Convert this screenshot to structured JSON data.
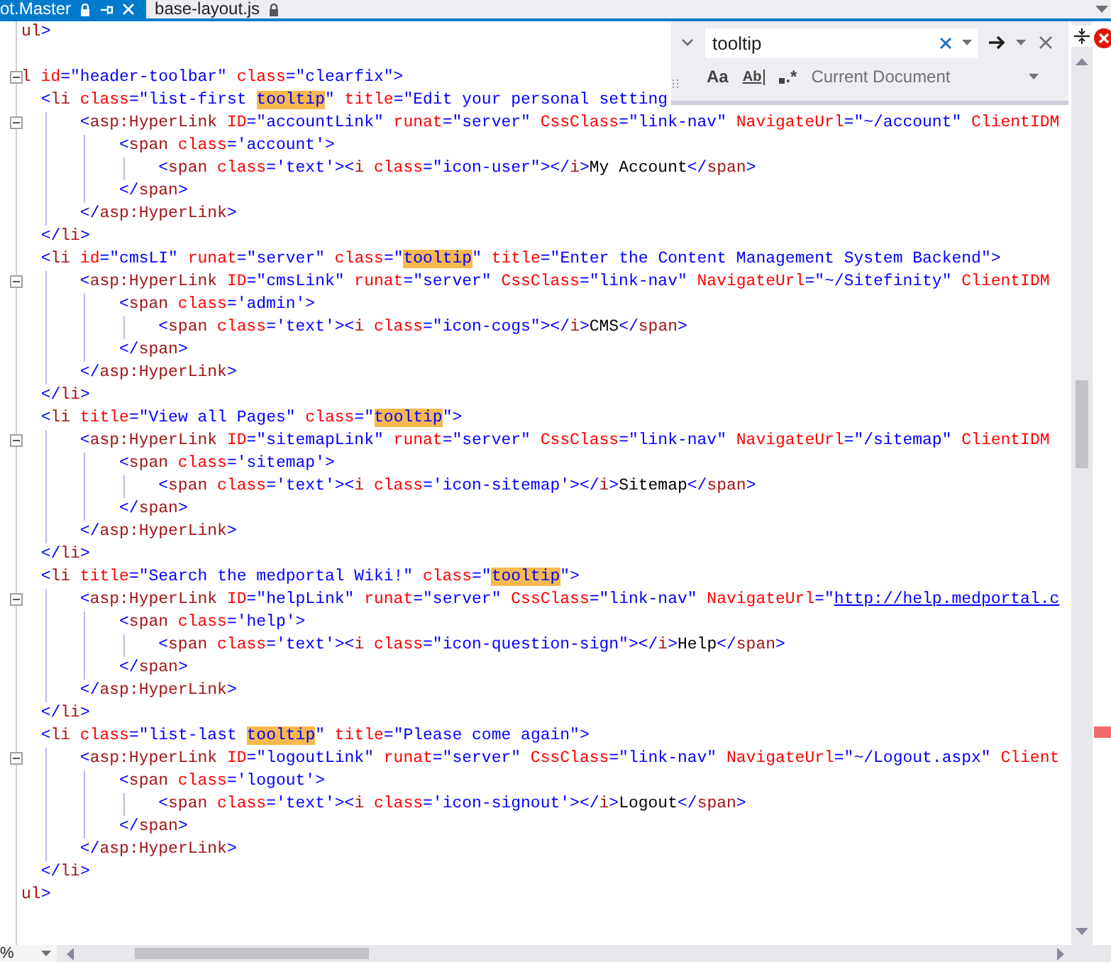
{
  "tabs": [
    {
      "label": "ot.Master",
      "selected": true,
      "locked": true
    },
    {
      "label": "base-layout.js",
      "selected": false,
      "locked": true
    }
  ],
  "find": {
    "value": "tooltip",
    "options": [
      {
        "label": "Aa"
      },
      {
        "label": "Ab"
      },
      {
        "label": ".*"
      }
    ],
    "scope": "Current Document"
  },
  "editor": {
    "lines": [
      {
        "collapsible": false,
        "tokens": [
          {
            "kind": "tag",
            "text": "ul"
          },
          {
            "kind": "delim",
            "text": ">"
          }
        ]
      },
      {
        "collapsible": false
      },
      {
        "collapsible": true,
        "tokens": [
          {
            "kind": "tag",
            "text": "l"
          },
          {
            "kind": "attr",
            "text": " id"
          },
          {
            "kind": "value",
            "text": "=\"header-toolbar\""
          },
          {
            "kind": "attr",
            "text": " class"
          },
          {
            "kind": "value",
            "text": "=\"clearfix\""
          },
          {
            "kind": "delim",
            "text": ">"
          }
        ]
      },
      {
        "collapsible": false,
        "tokens": [
          {
            "kind": "delim",
            "text": "  <"
          },
          {
            "kind": "tag",
            "text": "li"
          },
          {
            "kind": "attr",
            "text": " class"
          },
          {
            "kind": "value",
            "text": "=\"list-first "
          },
          {
            "kind": "match",
            "text": "tooltip"
          },
          {
            "kind": "value",
            "text": "\""
          },
          {
            "kind": "attr",
            "text": " title"
          },
          {
            "kind": "value",
            "text": "=\"Edit your personal setting"
          }
        ]
      },
      {
        "collapsible": true,
        "tokens": [
          {
            "kind": "delim",
            "text": "      <"
          },
          {
            "kind": "tag",
            "text": "asp:HyperLink"
          },
          {
            "kind": "attr",
            "text": " ID"
          },
          {
            "kind": "value",
            "text": "=\"accountLink\""
          },
          {
            "kind": "attr",
            "text": " runat"
          },
          {
            "kind": "value",
            "text": "=\"server\""
          },
          {
            "kind": "attr",
            "text": " CssClass"
          },
          {
            "kind": "value",
            "text": "=\"link-nav\""
          },
          {
            "kind": "attr",
            "text": " NavigateUrl"
          },
          {
            "kind": "value",
            "text": "=\"~/account\""
          },
          {
            "kind": "attr",
            "text": " ClientIDM"
          }
        ]
      },
      {
        "collapsible": false,
        "tokens": [
          {
            "kind": "delim",
            "text": "          <"
          },
          {
            "kind": "tag",
            "text": "span"
          },
          {
            "kind": "attr",
            "text": " class"
          },
          {
            "kind": "value",
            "text": "='account'"
          },
          {
            "kind": "delim",
            "text": ">"
          }
        ]
      },
      {
        "collapsible": false,
        "tokens": [
          {
            "kind": "delim",
            "text": "              <"
          },
          {
            "kind": "tag",
            "text": "span"
          },
          {
            "kind": "attr",
            "text": " class"
          },
          {
            "kind": "value",
            "text": "='text'"
          },
          {
            "kind": "delim",
            "text": "><"
          },
          {
            "kind": "tag",
            "text": "i"
          },
          {
            "kind": "attr",
            "text": " class"
          },
          {
            "kind": "value",
            "text": "=\"icon-user\""
          },
          {
            "kind": "delim",
            "text": "></"
          },
          {
            "kind": "tag",
            "text": "i"
          },
          {
            "kind": "delim",
            "text": ">"
          },
          {
            "kind": "text",
            "text": "My Account"
          },
          {
            "kind": "delim",
            "text": "</"
          },
          {
            "kind": "tag",
            "text": "span"
          },
          {
            "kind": "delim",
            "text": ">"
          }
        ]
      },
      {
        "collapsible": false,
        "tokens": [
          {
            "kind": "delim",
            "text": "          </"
          },
          {
            "kind": "tag",
            "text": "span"
          },
          {
            "kind": "delim",
            "text": ">"
          }
        ]
      },
      {
        "collapsible": false,
        "tokens": [
          {
            "kind": "delim",
            "text": "      </"
          },
          {
            "kind": "tag",
            "text": "asp:HyperLink"
          },
          {
            "kind": "delim",
            "text": ">"
          }
        ]
      },
      {
        "collapsible": false,
        "tokens": [
          {
            "kind": "delim",
            "text": "  </"
          },
          {
            "kind": "tag",
            "text": "li"
          },
          {
            "kind": "delim",
            "text": ">"
          }
        ]
      },
      {
        "collapsible": false,
        "tokens": [
          {
            "kind": "delim",
            "text": "  <"
          },
          {
            "kind": "tag",
            "text": "li"
          },
          {
            "kind": "attr",
            "text": " id"
          },
          {
            "kind": "value",
            "text": "=\"cmsLI\""
          },
          {
            "kind": "attr",
            "text": " runat"
          },
          {
            "kind": "value",
            "text": "=\"server\""
          },
          {
            "kind": "attr",
            "text": " class"
          },
          {
            "kind": "value",
            "text": "=\""
          },
          {
            "kind": "match",
            "text": "tooltip"
          },
          {
            "kind": "value",
            "text": "\""
          },
          {
            "kind": "attr",
            "text": " title"
          },
          {
            "kind": "value",
            "text": "=\"Enter the Content Management System Backend\""
          },
          {
            "kind": "delim",
            "text": ">"
          }
        ]
      },
      {
        "collapsible": true,
        "tokens": [
          {
            "kind": "delim",
            "text": "      <"
          },
          {
            "kind": "tag",
            "text": "asp:HyperLink"
          },
          {
            "kind": "attr",
            "text": " ID"
          },
          {
            "kind": "value",
            "text": "=\"cmsLink\""
          },
          {
            "kind": "attr",
            "text": " runat"
          },
          {
            "kind": "value",
            "text": "=\"server\""
          },
          {
            "kind": "attr",
            "text": " CssClass"
          },
          {
            "kind": "value",
            "text": "=\"link-nav\""
          },
          {
            "kind": "attr",
            "text": " NavigateUrl"
          },
          {
            "kind": "value",
            "text": "=\"~/Sitefinity\""
          },
          {
            "kind": "attr",
            "text": " ClientIDM"
          }
        ]
      },
      {
        "collapsible": false,
        "tokens": [
          {
            "kind": "delim",
            "text": "          <"
          },
          {
            "kind": "tag",
            "text": "span"
          },
          {
            "kind": "attr",
            "text": " class"
          },
          {
            "kind": "value",
            "text": "='admin'"
          },
          {
            "kind": "delim",
            "text": ">"
          }
        ]
      },
      {
        "collapsible": false,
        "tokens": [
          {
            "kind": "delim",
            "text": "              <"
          },
          {
            "kind": "tag",
            "text": "span"
          },
          {
            "kind": "attr",
            "text": " class"
          },
          {
            "kind": "value",
            "text": "='text'"
          },
          {
            "kind": "delim",
            "text": "><"
          },
          {
            "kind": "tag",
            "text": "i"
          },
          {
            "kind": "attr",
            "text": " class"
          },
          {
            "kind": "value",
            "text": "=\"icon-cogs\""
          },
          {
            "kind": "delim",
            "text": "></"
          },
          {
            "kind": "tag",
            "text": "i"
          },
          {
            "kind": "delim",
            "text": ">"
          },
          {
            "kind": "text",
            "text": "CMS"
          },
          {
            "kind": "delim",
            "text": "</"
          },
          {
            "kind": "tag",
            "text": "span"
          },
          {
            "kind": "delim",
            "text": ">"
          }
        ]
      },
      {
        "collapsible": false,
        "tokens": [
          {
            "kind": "delim",
            "text": "          </"
          },
          {
            "kind": "tag",
            "text": "span"
          },
          {
            "kind": "delim",
            "text": ">"
          }
        ]
      },
      {
        "collapsible": false,
        "tokens": [
          {
            "kind": "delim",
            "text": "      </"
          },
          {
            "kind": "tag",
            "text": "asp:HyperLink"
          },
          {
            "kind": "delim",
            "text": ">"
          }
        ]
      },
      {
        "collapsible": false,
        "tokens": [
          {
            "kind": "delim",
            "text": "  </"
          },
          {
            "kind": "tag",
            "text": "li"
          },
          {
            "kind": "delim",
            "text": ">"
          }
        ]
      },
      {
        "collapsible": false,
        "tokens": [
          {
            "kind": "delim",
            "text": "  <"
          },
          {
            "kind": "tag",
            "text": "li"
          },
          {
            "kind": "attr",
            "text": " title"
          },
          {
            "kind": "value",
            "text": "=\"View all Pages\""
          },
          {
            "kind": "attr",
            "text": " class"
          },
          {
            "kind": "value",
            "text": "=\""
          },
          {
            "kind": "match",
            "text": "tooltip"
          },
          {
            "kind": "value",
            "text": "\""
          },
          {
            "kind": "delim",
            "text": ">"
          }
        ]
      },
      {
        "collapsible": true,
        "tokens": [
          {
            "kind": "delim",
            "text": "      <"
          },
          {
            "kind": "tag",
            "text": "asp:HyperLink"
          },
          {
            "kind": "attr",
            "text": " ID"
          },
          {
            "kind": "value",
            "text": "=\"sitemapLink\""
          },
          {
            "kind": "attr",
            "text": " runat"
          },
          {
            "kind": "value",
            "text": "=\"server\""
          },
          {
            "kind": "attr",
            "text": " CssClass"
          },
          {
            "kind": "value",
            "text": "=\"link-nav\""
          },
          {
            "kind": "attr",
            "text": " NavigateUrl"
          },
          {
            "kind": "value",
            "text": "=\"/sitemap\""
          },
          {
            "kind": "attr",
            "text": " ClientIDM"
          }
        ]
      },
      {
        "collapsible": false,
        "tokens": [
          {
            "kind": "delim",
            "text": "          <"
          },
          {
            "kind": "tag",
            "text": "span"
          },
          {
            "kind": "attr",
            "text": " class"
          },
          {
            "kind": "value",
            "text": "='sitemap'"
          },
          {
            "kind": "delim",
            "text": ">"
          }
        ]
      },
      {
        "collapsible": false,
        "tokens": [
          {
            "kind": "delim",
            "text": "              <"
          },
          {
            "kind": "tag",
            "text": "span"
          },
          {
            "kind": "attr",
            "text": " class"
          },
          {
            "kind": "value",
            "text": "='text'"
          },
          {
            "kind": "delim",
            "text": "><"
          },
          {
            "kind": "tag",
            "text": "i"
          },
          {
            "kind": "attr",
            "text": " class"
          },
          {
            "kind": "value",
            "text": "='icon-sitemap'"
          },
          {
            "kind": "delim",
            "text": "></"
          },
          {
            "kind": "tag",
            "text": "i"
          },
          {
            "kind": "delim",
            "text": ">"
          },
          {
            "kind": "text",
            "text": "Sitemap"
          },
          {
            "kind": "delim",
            "text": "</"
          },
          {
            "kind": "tag",
            "text": "span"
          },
          {
            "kind": "delim",
            "text": ">"
          }
        ]
      },
      {
        "collapsible": false,
        "tokens": [
          {
            "kind": "delim",
            "text": "          </"
          },
          {
            "kind": "tag",
            "text": "span"
          },
          {
            "kind": "delim",
            "text": ">"
          }
        ]
      },
      {
        "collapsible": false,
        "tokens": [
          {
            "kind": "delim",
            "text": "      </"
          },
          {
            "kind": "tag",
            "text": "asp:HyperLink"
          },
          {
            "kind": "delim",
            "text": ">"
          }
        ]
      },
      {
        "collapsible": false,
        "tokens": [
          {
            "kind": "delim",
            "text": "  </"
          },
          {
            "kind": "tag",
            "text": "li"
          },
          {
            "kind": "delim",
            "text": ">"
          }
        ]
      },
      {
        "collapsible": false,
        "tokens": [
          {
            "kind": "delim",
            "text": "  <"
          },
          {
            "kind": "tag",
            "text": "li"
          },
          {
            "kind": "attr",
            "text": " title"
          },
          {
            "kind": "value",
            "text": "=\"Search the medportal Wiki!\""
          },
          {
            "kind": "attr",
            "text": " class"
          },
          {
            "kind": "value",
            "text": "=\""
          },
          {
            "kind": "match",
            "text": "tooltip"
          },
          {
            "kind": "value",
            "text": "\""
          },
          {
            "kind": "delim",
            "text": ">"
          }
        ]
      },
      {
        "collapsible": true,
        "tokens": [
          {
            "kind": "delim",
            "text": "      <"
          },
          {
            "kind": "tag",
            "text": "asp:HyperLink"
          },
          {
            "kind": "attr",
            "text": " ID"
          },
          {
            "kind": "value",
            "text": "=\"helpLink\""
          },
          {
            "kind": "attr",
            "text": " runat"
          },
          {
            "kind": "value",
            "text": "=\"server\""
          },
          {
            "kind": "attr",
            "text": " CssClass"
          },
          {
            "kind": "value",
            "text": "=\"link-nav\""
          },
          {
            "kind": "attr",
            "text": " NavigateUrl"
          },
          {
            "kind": "value",
            "text": "=\""
          },
          {
            "kind": "link",
            "text": "http://help.medportal.c"
          }
        ]
      },
      {
        "collapsible": false,
        "tokens": [
          {
            "kind": "delim",
            "text": "          <"
          },
          {
            "kind": "tag",
            "text": "span"
          },
          {
            "kind": "attr",
            "text": " class"
          },
          {
            "kind": "value",
            "text": "='help'"
          },
          {
            "kind": "delim",
            "text": ">"
          }
        ]
      },
      {
        "collapsible": false,
        "tokens": [
          {
            "kind": "delim",
            "text": "              <"
          },
          {
            "kind": "tag",
            "text": "span"
          },
          {
            "kind": "attr",
            "text": " class"
          },
          {
            "kind": "value",
            "text": "='text'"
          },
          {
            "kind": "delim",
            "text": "><"
          },
          {
            "kind": "tag",
            "text": "i"
          },
          {
            "kind": "attr",
            "text": " class"
          },
          {
            "kind": "value",
            "text": "=\"icon-question-sign\""
          },
          {
            "kind": "delim",
            "text": "></"
          },
          {
            "kind": "tag",
            "text": "i"
          },
          {
            "kind": "delim",
            "text": ">"
          },
          {
            "kind": "text",
            "text": "Help"
          },
          {
            "kind": "delim",
            "text": "</"
          },
          {
            "kind": "tag",
            "text": "span"
          },
          {
            "kind": "delim",
            "text": ">"
          }
        ]
      },
      {
        "collapsible": false,
        "tokens": [
          {
            "kind": "delim",
            "text": "          </"
          },
          {
            "kind": "tag",
            "text": "span"
          },
          {
            "kind": "delim",
            "text": ">"
          }
        ]
      },
      {
        "collapsible": false,
        "tokens": [
          {
            "kind": "delim",
            "text": "      </"
          },
          {
            "kind": "tag",
            "text": "asp:HyperLink"
          },
          {
            "kind": "delim",
            "text": ">"
          }
        ]
      },
      {
        "collapsible": false,
        "tokens": [
          {
            "kind": "delim",
            "text": "  </"
          },
          {
            "kind": "tag",
            "text": "li"
          },
          {
            "kind": "delim",
            "text": ">"
          }
        ]
      },
      {
        "collapsible": false,
        "tokens": [
          {
            "kind": "delim",
            "text": "  <"
          },
          {
            "kind": "tag",
            "text": "li"
          },
          {
            "kind": "attr",
            "text": " class"
          },
          {
            "kind": "value",
            "text": "=\"list-last "
          },
          {
            "kind": "match",
            "text": "tooltip"
          },
          {
            "kind": "value",
            "text": "\""
          },
          {
            "kind": "attr",
            "text": " title"
          },
          {
            "kind": "value",
            "text": "=\"Please come again\""
          },
          {
            "kind": "delim",
            "text": ">"
          }
        ]
      },
      {
        "collapsible": true,
        "tokens": [
          {
            "kind": "delim",
            "text": "      <"
          },
          {
            "kind": "tag",
            "text": "asp:HyperLink"
          },
          {
            "kind": "attr",
            "text": " ID"
          },
          {
            "kind": "value",
            "text": "=\"logoutLink\""
          },
          {
            "kind": "attr",
            "text": " runat"
          },
          {
            "kind": "value",
            "text": "=\"server\""
          },
          {
            "kind": "attr",
            "text": " CssClass"
          },
          {
            "kind": "value",
            "text": "=\"link-nav\""
          },
          {
            "kind": "attr",
            "text": " NavigateUrl"
          },
          {
            "kind": "value",
            "text": "=\"~/Logout.aspx\""
          },
          {
            "kind": "attr",
            "text": " Client"
          }
        ]
      },
      {
        "collapsible": false,
        "tokens": [
          {
            "kind": "delim",
            "text": "          <"
          },
          {
            "kind": "tag",
            "text": "span"
          },
          {
            "kind": "attr",
            "text": " class"
          },
          {
            "kind": "value",
            "text": "='logout'"
          },
          {
            "kind": "delim",
            "text": ">"
          }
        ]
      },
      {
        "collapsible": false,
        "tokens": [
          {
            "kind": "delim",
            "text": "              <"
          },
          {
            "kind": "tag",
            "text": "span"
          },
          {
            "kind": "attr",
            "text": " class"
          },
          {
            "kind": "value",
            "text": "='text'"
          },
          {
            "kind": "delim",
            "text": "><"
          },
          {
            "kind": "tag",
            "text": "i"
          },
          {
            "kind": "attr",
            "text": " class"
          },
          {
            "kind": "value",
            "text": "='icon-signout'"
          },
          {
            "kind": "delim",
            "text": "></"
          },
          {
            "kind": "tag",
            "text": "i"
          },
          {
            "kind": "delim",
            "text": ">"
          },
          {
            "kind": "text",
            "text": "Logout"
          },
          {
            "kind": "delim",
            "text": "</"
          },
          {
            "kind": "tag",
            "text": "span"
          },
          {
            "kind": "delim",
            "text": ">"
          }
        ]
      },
      {
        "collapsible": false,
        "tokens": [
          {
            "kind": "delim",
            "text": "          </"
          },
          {
            "kind": "tag",
            "text": "span"
          },
          {
            "kind": "delim",
            "text": ">"
          }
        ]
      },
      {
        "collapsible": false,
        "tokens": [
          {
            "kind": "delim",
            "text": "      </"
          },
          {
            "kind": "tag",
            "text": "asp:HyperLink"
          },
          {
            "kind": "delim",
            "text": ">"
          }
        ]
      },
      {
        "collapsible": false,
        "tokens": [
          {
            "kind": "delim",
            "text": "  </"
          },
          {
            "kind": "tag",
            "text": "li"
          },
          {
            "kind": "delim",
            "text": ">"
          }
        ]
      },
      {
        "collapsible": false,
        "tokens": [
          {
            "kind": "tag",
            "text": "ul"
          },
          {
            "kind": "delim",
            "text": ">"
          }
        ]
      }
    ]
  },
  "zoom_level": "%"
}
